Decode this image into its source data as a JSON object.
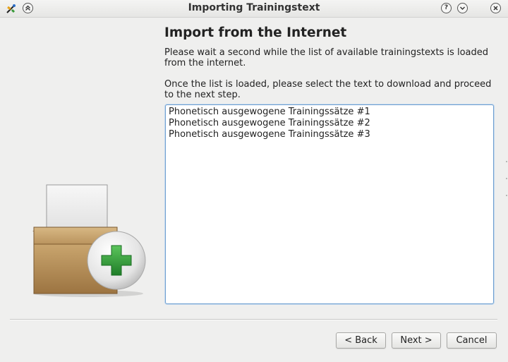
{
  "window": {
    "title": "Importing Trainingstext",
    "app_icon": "app-logo-icon",
    "buttons": {
      "menu": "chevron-up-icon",
      "help": "?",
      "minimize": "chevron-down-icon",
      "close": "close-icon"
    }
  },
  "page": {
    "heading": "Import from the Internet",
    "paragraph1": "Please wait a second while the list of available trainingstexts is loaded from the internet.",
    "paragraph2": "Once the list is loaded, please select the text to download and proceed to the next step."
  },
  "list": {
    "items": [
      "Phonetisch ausgewogene Trainingssätze #1",
      "Phonetisch ausgewogene Trainingssätze #2",
      "Phonetisch ausgewogene Trainingssätze #3"
    ]
  },
  "buttons": {
    "back": "< Back",
    "next": "Next >",
    "cancel": "Cancel"
  },
  "illustration": {
    "name": "box-with-plus-icon"
  },
  "colors": {
    "accent": "#6f9fd0",
    "plus_green": "#2e9a3a",
    "box_brown": "#b8925c"
  }
}
